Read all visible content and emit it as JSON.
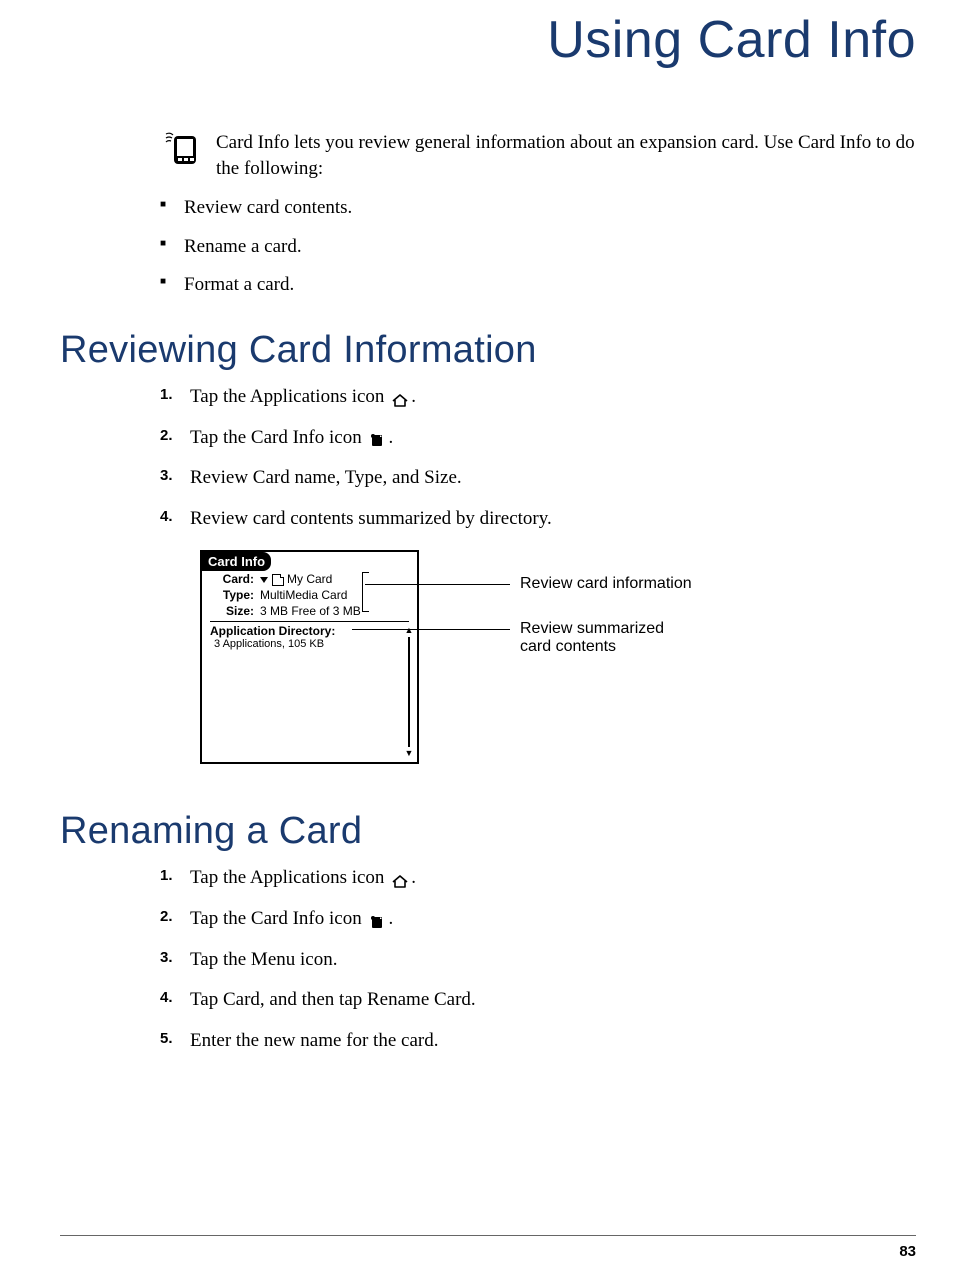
{
  "chapterTitle": "Using Card Info",
  "intro": "Card Info lets you review general information about an expansion card. Use Card Info to do the following:",
  "introBullets": [
    "Review card contents.",
    "Rename a card.",
    "Format a card."
  ],
  "section1": {
    "title": "Reviewing Card Information",
    "steps": [
      {
        "pre": "Tap the Applications icon ",
        "icon": "home-icon",
        "post": "."
      },
      {
        "pre": "Tap the Card Info icon ",
        "icon": "card-info-icon",
        "post": "."
      },
      {
        "pre": "Review Card name, Type, and Size.",
        "icon": null,
        "post": ""
      },
      {
        "pre": "Review card contents summarized by directory.",
        "icon": null,
        "post": ""
      }
    ]
  },
  "palmScreen": {
    "title": "Card Info",
    "cardLabel": "Card:",
    "cardValue": "My Card",
    "typeLabel": "Type:",
    "typeValue": "MultiMedia Card",
    "sizeLabel": "Size:",
    "sizeValue": "3 MB Free of 3 MB",
    "appDirLabel": "Application Directory:",
    "appDirSummary": "3 Applications, 105 KB"
  },
  "callouts": {
    "callout1": "Review card information",
    "callout2a": "Review summarized",
    "callout2b": "card contents"
  },
  "section2": {
    "title": "Renaming a Card",
    "steps": [
      {
        "pre": "Tap the Applications icon ",
        "icon": "home-icon",
        "post": "."
      },
      {
        "pre": "Tap the Card Info icon ",
        "icon": "card-info-icon",
        "post": "."
      },
      {
        "pre": "Tap the Menu icon.",
        "icon": null,
        "post": ""
      },
      {
        "pre": "Tap Card, and then tap Rename Card.",
        "icon": null,
        "post": ""
      },
      {
        "pre": "Enter the new name for the card.",
        "icon": null,
        "post": ""
      }
    ]
  },
  "pageNumber": "83"
}
